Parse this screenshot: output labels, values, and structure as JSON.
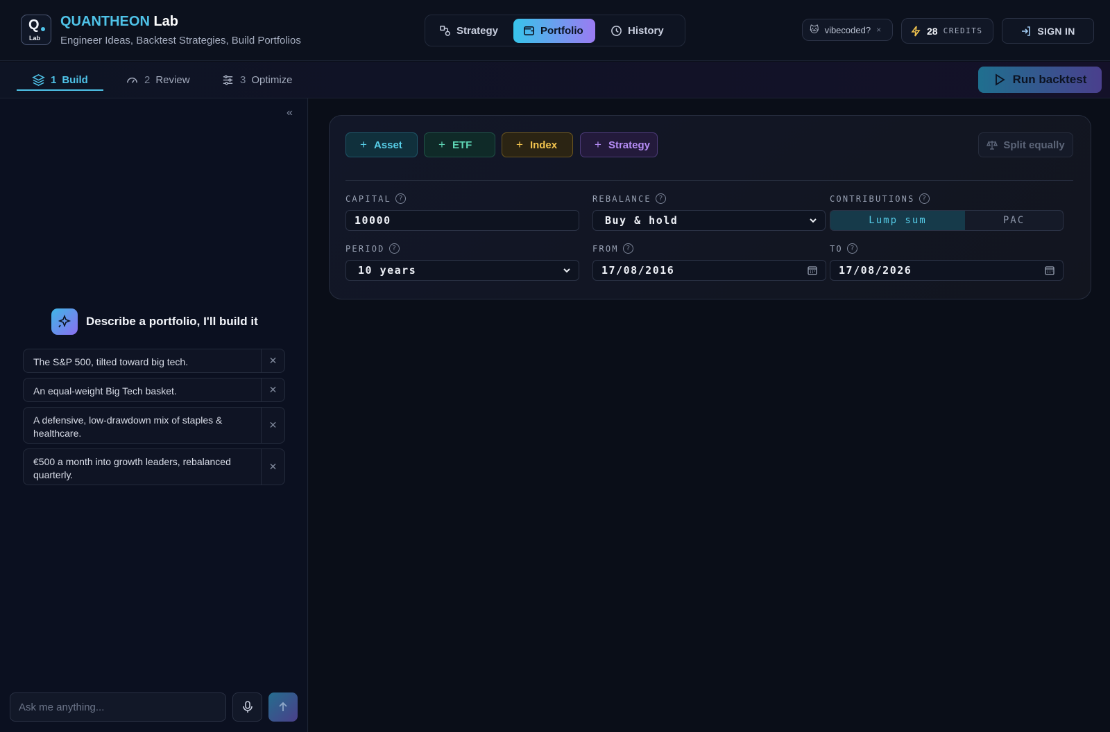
{
  "header": {
    "logo_letter": "Q",
    "logo_sub": "Lab",
    "brand_primary": "QUANTHEON",
    "brand_secondary": "Lab",
    "tagline": "Engineer Ideas, Backtest Strategies, Build Portfolios",
    "modes": [
      {
        "label": "Strategy",
        "icon": "strategy-icon",
        "active": false
      },
      {
        "label": "Portfolio",
        "icon": "wallet-icon",
        "active": true
      },
      {
        "label": "History",
        "icon": "clock-icon",
        "active": false
      }
    ],
    "vibecoded_label": "vibecoded?",
    "vibecoded_close": "×",
    "credits_count": "28",
    "credits_label": "CREDITS",
    "sign_in_label": "SIGN IN"
  },
  "steps": [
    {
      "num": "1",
      "label": "Build",
      "active": true
    },
    {
      "num": "2",
      "label": "Review",
      "active": false
    },
    {
      "num": "3",
      "label": "Optimize",
      "active": false
    }
  ],
  "run_backtest_label": "Run backtest",
  "chat": {
    "collapse_glyph": "«",
    "title": "Describe a portfolio, I'll build it",
    "suggestions": [
      "The S&P 500, tilted toward big tech.",
      "An equal-weight Big Tech basket.",
      "A defensive, low-drawdown mix of staples & healthcare.",
      "€500 a month into growth leaders, rebalanced quarterly."
    ],
    "input_placeholder": "Ask me anything..."
  },
  "builder": {
    "add_buttons": {
      "asset": "Asset",
      "etf": "ETF",
      "index": "Index",
      "strategy": "Strategy"
    },
    "split_equally_label": "Split equally",
    "fields": {
      "capital": {
        "label": "CAPITAL",
        "value": "10000"
      },
      "rebalance": {
        "label": "REBALANCE",
        "value": "Buy & hold"
      },
      "contributions": {
        "label": "CONTRIBUTIONS",
        "options": [
          "Lump sum",
          "PAC"
        ],
        "selected": "Lump sum"
      },
      "period": {
        "label": "PERIOD",
        "value": "10 years"
      },
      "from": {
        "label": "FROM",
        "value": "17/08/2016"
      },
      "to": {
        "label": "TO",
        "value": "17/08/2026"
      }
    }
  },
  "colors": {
    "accent_cyan": "#4fc3e8",
    "accent_purple": "#9b7bf2",
    "etf_green": "#5fd7b6",
    "index_gold": "#f1c34e",
    "strategy_violet": "#b58cf5"
  }
}
